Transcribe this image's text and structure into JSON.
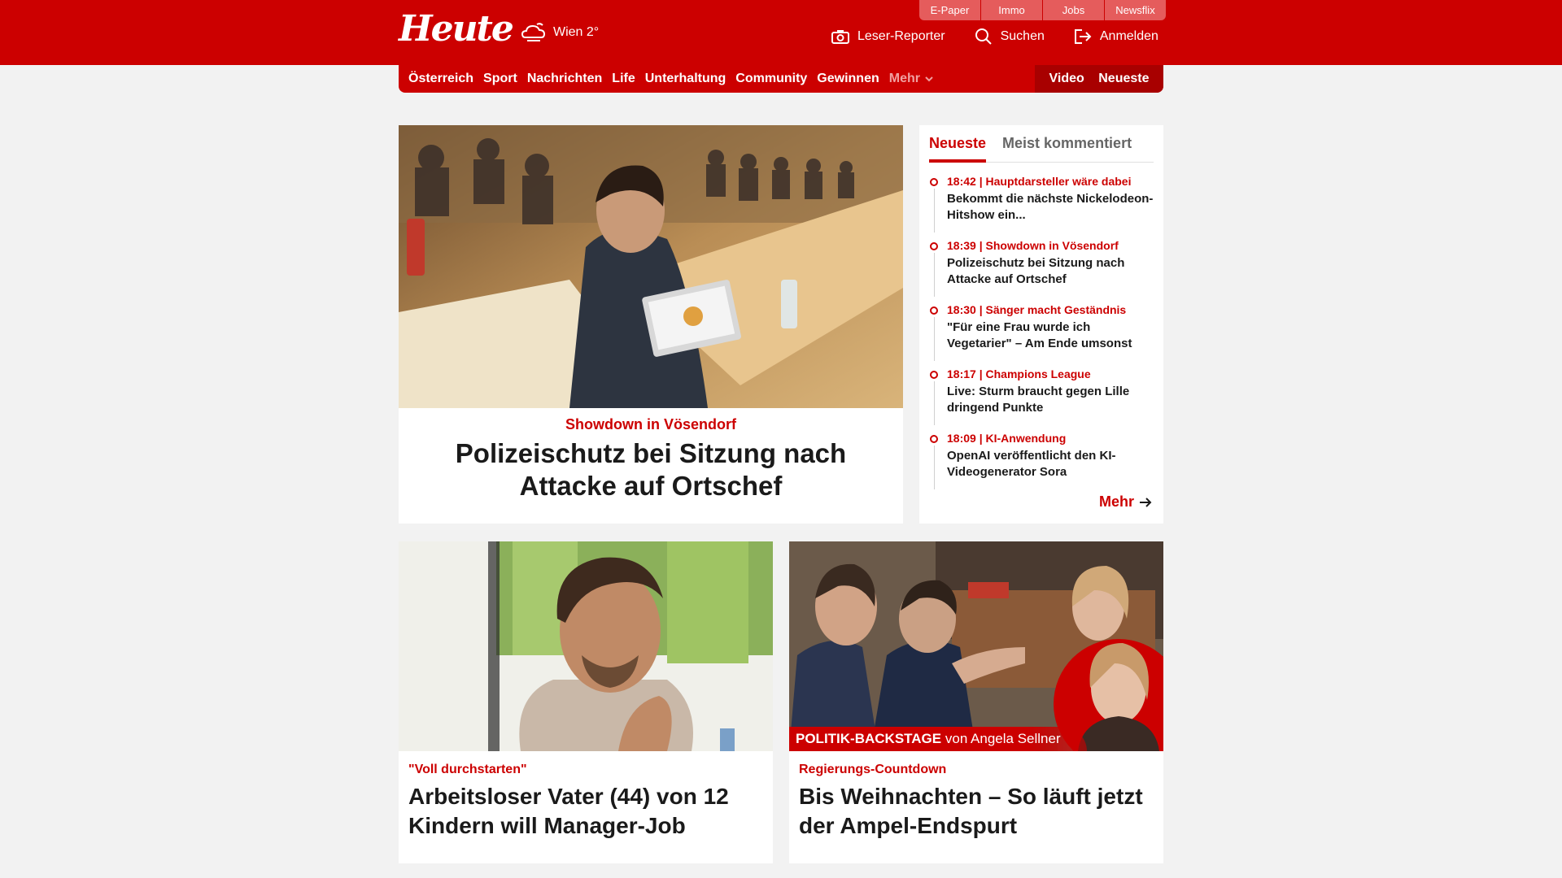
{
  "header": {
    "logo": "Heute",
    "weather": "Wien 2°",
    "top_links": [
      "E-Paper",
      "Immo",
      "Jobs",
      "Newsflix"
    ],
    "actions": {
      "reporter": "Leser-Reporter",
      "search": "Suchen",
      "login": "Anmelden"
    }
  },
  "nav": {
    "items": [
      "Österreich",
      "Sport",
      "Nachrichten",
      "Life",
      "Unterhaltung",
      "Community",
      "Gewinnen"
    ],
    "more": "Mehr",
    "video": "Video",
    "latest": "Neueste"
  },
  "hero": {
    "kicker": "Showdown in Vösendorf",
    "title": "Polizeischutz bei Sitzung nach Attacke auf Ortschef"
  },
  "sidebar": {
    "tab_active": "Neueste",
    "tab_inactive": "Meist kommentiert",
    "items": [
      {
        "meta": "18:42 | Hauptdarsteller wäre dabei",
        "title": "Bekommt die nächste Nickelodeon-Hitshow ein..."
      },
      {
        "meta": "18:39 | Showdown in Vösendorf",
        "title": "Polizeischutz bei Sitzung nach Attacke auf Ortschef"
      },
      {
        "meta": "18:30 | Sänger macht Geständnis",
        "title": "\"Für eine Frau wurde ich Vegetarier\" – Am Ende umsonst"
      },
      {
        "meta": "18:17 | Champions League",
        "title": "Live: Sturm braucht gegen Lille dringend Punkte"
      },
      {
        "meta": "18:09 | KI-Anwendung",
        "title": "OpenAI veröffentlicht den KI-Videogenerator Sora"
      }
    ],
    "more": "Mehr"
  },
  "cards": [
    {
      "kicker": "\"Voll durchstarten\"",
      "title": "Arbeitsloser Vater (44) von 12 Kindern will Manager-Job"
    },
    {
      "kicker": "Regierungs-Countdown",
      "title": "Bis Weihnachten – So läuft jetzt der Ampel-Endspurt",
      "banner_bold": "POLITIK-BACKSTAGE",
      "banner_rest": "von Angela Sellner"
    }
  ],
  "colors": {
    "brand": "#cc0000",
    "background": "#f2f2f2"
  }
}
